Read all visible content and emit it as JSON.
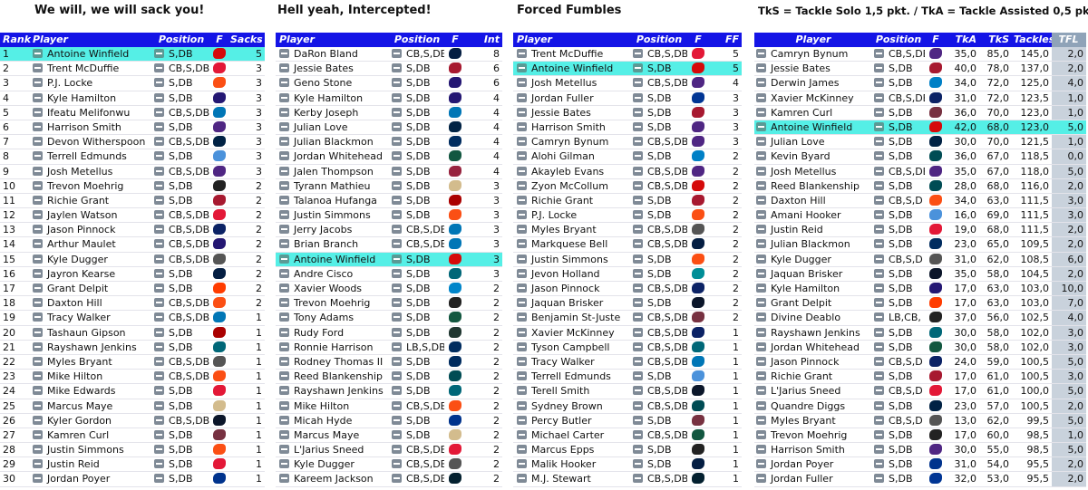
{
  "titles": {
    "sacks": "We will, we will sack you!",
    "ints": "Hell yeah, Intercepted!",
    "ff": "Forced Fumbles",
    "tackles": "TkS = Tackle Solo 1,5 pkt. / TkA = Tackle Assisted 0,5 pkt."
  },
  "team_colors": {
    "TB": "#d50a0a",
    "CIN": "#fb4f14",
    "DEN": "#fb4f14",
    "BAL": "#241773",
    "DET": "#0076b6",
    "MIN": "#4f2683",
    "TEN": "#4b92db",
    "LV": "#222222",
    "KC": "#e31837",
    "JAX": "#006778",
    "NYG": "#0b2265",
    "DAL": "#041e42",
    "CLE": "#ff3c00",
    "BUF": "#00338d",
    "CHI": "#0b162a",
    "WAS": "#773141",
    "HOU": "#03202f",
    "LAR": "#003594",
    "DAL2": "#041e42",
    "SF": "#aa0000",
    "IND": "#002c5f",
    "NYJ": "#125740",
    "ARI": "#97233f",
    "NO": "#d3bc8d",
    "CAR": "#0085ca",
    "GB": "#203731",
    "PHI": "#004c54",
    "ATL": "#a71930",
    "LAC": "#0080c6",
    "MIA": "#008e97",
    "SEA": "#002244",
    "PIT": "#ffb612"
  },
  "sacks_table": {
    "headers": [
      "Rank",
      "Player",
      "Position",
      "F",
      "Sacks"
    ],
    "rows": [
      {
        "rank": "1",
        "player": "Antoine Winfield",
        "pos": "S,DB",
        "team": "TB",
        "val": "5",
        "hl": true
      },
      {
        "rank": "2",
        "player": "Trent McDuffie",
        "pos": "CB,S,DB",
        "team": "KC",
        "val": "3"
      },
      {
        "rank": "3",
        "player": "P.J. Locke",
        "pos": "S,DB",
        "team": "DEN",
        "val": "3"
      },
      {
        "rank": "4",
        "player": "Kyle Hamilton",
        "pos": "S,DB",
        "team": "BAL",
        "val": "3"
      },
      {
        "rank": "5",
        "player": "Ifeatu Melifonwu",
        "pos": "CB,S,DB",
        "team": "DET",
        "val": "3"
      },
      {
        "rank": "6",
        "player": "Harrison Smith",
        "pos": "S,DB",
        "team": "MIN",
        "val": "3"
      },
      {
        "rank": "7",
        "player": "Devon Witherspoon",
        "pos": "CB,S,DB",
        "team": "SEA",
        "val": "3"
      },
      {
        "rank": "8",
        "player": "Terrell Edmunds",
        "pos": "S,DB",
        "team": "TEN",
        "val": "3"
      },
      {
        "rank": "9",
        "player": "Josh Metellus",
        "pos": "CB,S,DB",
        "team": "MIN",
        "val": "3"
      },
      {
        "rank": "10",
        "player": "Trevon Moehrig",
        "pos": "S,DB",
        "team": "LV",
        "val": "2"
      },
      {
        "rank": "11",
        "player": "Richie Grant",
        "pos": "S,DB",
        "team": "ATL",
        "val": "2"
      },
      {
        "rank": "12",
        "player": "Jaylen Watson",
        "pos": "CB,S,DB",
        "team": "KC",
        "val": "2"
      },
      {
        "rank": "13",
        "player": "Jason Pinnock",
        "pos": "CB,S,DB",
        "team": "NYG",
        "val": "2"
      },
      {
        "rank": "14",
        "player": "Arthur Maulet",
        "pos": "CB,S,DB",
        "team": "BAL",
        "val": "2"
      },
      {
        "rank": "15",
        "player": "Kyle Dugger",
        "pos": "CB,S,DB",
        "team": "NE",
        "val": "2"
      },
      {
        "rank": "16",
        "player": "Jayron Kearse",
        "pos": "S,DB",
        "team": "DAL",
        "val": "2"
      },
      {
        "rank": "17",
        "player": "Grant Delpit",
        "pos": "S,DB",
        "team": "CLE",
        "val": "2"
      },
      {
        "rank": "18",
        "player": "Daxton Hill",
        "pos": "CB,S,DB",
        "team": "CIN",
        "val": "2"
      },
      {
        "rank": "19",
        "player": "Tracy Walker",
        "pos": "CB,S,DB",
        "team": "DET",
        "val": "1"
      },
      {
        "rank": "20",
        "player": "Tashaun Gipson",
        "pos": "S,DB",
        "team": "SF",
        "val": "1"
      },
      {
        "rank": "21",
        "player": "Rayshawn Jenkins",
        "pos": "S,DB",
        "team": "JAX",
        "val": "1"
      },
      {
        "rank": "22",
        "player": "Myles Bryant",
        "pos": "CB,S,DB",
        "team": "NE",
        "val": "1"
      },
      {
        "rank": "23",
        "player": "Mike Hilton",
        "pos": "CB,S,DB",
        "team": "CIN",
        "val": "1"
      },
      {
        "rank": "24",
        "player": "Mike Edwards",
        "pos": "S,DB",
        "team": "KC",
        "val": "1"
      },
      {
        "rank": "25",
        "player": "Marcus Maye",
        "pos": "S,DB",
        "team": "NO",
        "val": "1"
      },
      {
        "rank": "26",
        "player": "Kyler Gordon",
        "pos": "CB,S,DB",
        "team": "CHI",
        "val": "1"
      },
      {
        "rank": "27",
        "player": "Kamren Curl",
        "pos": "S,DB",
        "team": "WAS",
        "val": "1"
      },
      {
        "rank": "28",
        "player": "Justin Simmons",
        "pos": "S,DB",
        "team": "DEN",
        "val": "1"
      },
      {
        "rank": "29",
        "player": "Justin Reid",
        "pos": "S,DB",
        "team": "KC",
        "val": "1"
      },
      {
        "rank": "30",
        "player": "Jordan Poyer",
        "pos": "S,DB",
        "team": "BUF",
        "val": "1"
      }
    ]
  },
  "ints_table": {
    "headers": [
      "Player",
      "Position",
      "F",
      "Int"
    ],
    "rows": [
      {
        "player": "DaRon Bland",
        "pos": "CB,S,DB",
        "team": "DAL",
        "val": "8"
      },
      {
        "player": "Jessie Bates",
        "pos": "S,DB",
        "team": "ATL",
        "val": "6"
      },
      {
        "player": "Geno Stone",
        "pos": "S,DB",
        "team": "BAL",
        "val": "6"
      },
      {
        "player": "Kyle Hamilton",
        "pos": "S,DB",
        "team": "BAL",
        "val": "4"
      },
      {
        "player": "Kerby Joseph",
        "pos": "S,DB",
        "team": "DET",
        "val": "4"
      },
      {
        "player": "Julian Love",
        "pos": "S,DB",
        "team": "SEA",
        "val": "4"
      },
      {
        "player": "Julian Blackmon",
        "pos": "S,DB",
        "team": "IND",
        "val": "4"
      },
      {
        "player": "Jordan Whitehead",
        "pos": "S,DB",
        "team": "NYJ",
        "val": "4"
      },
      {
        "player": "Jalen Thompson",
        "pos": "S,DB",
        "team": "ARI",
        "val": "4"
      },
      {
        "player": "Tyrann Mathieu",
        "pos": "S,DB",
        "team": "NO",
        "val": "3"
      },
      {
        "player": "Talanoa Hufanga",
        "pos": "S,DB",
        "team": "SF",
        "val": "3"
      },
      {
        "player": "Justin Simmons",
        "pos": "S,DB",
        "team": "DEN",
        "val": "3"
      },
      {
        "player": "Jerry Jacobs",
        "pos": "CB,S,DB",
        "team": "DET",
        "val": "3"
      },
      {
        "player": "Brian Branch",
        "pos": "CB,S,DB",
        "team": "DET",
        "val": "3"
      },
      {
        "player": "Antoine Winfield",
        "pos": "S,DB",
        "team": "TB",
        "val": "3",
        "hl": true
      },
      {
        "player": "Andre Cisco",
        "pos": "S,DB",
        "team": "JAX",
        "val": "3"
      },
      {
        "player": "Xavier Woods",
        "pos": "S,DB",
        "team": "CAR",
        "val": "2"
      },
      {
        "player": "Trevon Moehrig",
        "pos": "S,DB",
        "team": "LV",
        "val": "2"
      },
      {
        "player": "Tony Adams",
        "pos": "S,DB",
        "team": "NYJ",
        "val": "2"
      },
      {
        "player": "Rudy Ford",
        "pos": "S,DB",
        "team": "GB",
        "val": "2"
      },
      {
        "player": "Ronnie Harrison",
        "pos": "LB,S,DB",
        "team": "IND",
        "val": "2"
      },
      {
        "player": "Rodney Thomas II",
        "pos": "S,DB",
        "team": "IND",
        "val": "2"
      },
      {
        "player": "Reed Blankenship",
        "pos": "S,DB",
        "team": "PHI",
        "val": "2"
      },
      {
        "player": "Rayshawn Jenkins",
        "pos": "S,DB",
        "team": "JAX",
        "val": "2"
      },
      {
        "player": "Mike Hilton",
        "pos": "CB,S,DB",
        "team": "CIN",
        "val": "2"
      },
      {
        "player": "Micah Hyde",
        "pos": "S,DB",
        "team": "BUF",
        "val": "2"
      },
      {
        "player": "Marcus Maye",
        "pos": "S,DB",
        "team": "NO",
        "val": "2"
      },
      {
        "player": "L'Jarius Sneed",
        "pos": "CB,S,DB",
        "team": "KC",
        "val": "2"
      },
      {
        "player": "Kyle Dugger",
        "pos": "CB,S,DB",
        "team": "NE",
        "val": "2"
      },
      {
        "player": "Kareem Jackson",
        "pos": "CB,S,DB",
        "team": "HOU",
        "val": "2"
      }
    ]
  },
  "ff_table": {
    "headers": [
      "Player",
      "Position",
      "F",
      "FF"
    ],
    "rows": [
      {
        "player": "Trent McDuffie",
        "pos": "CB,S,DB",
        "team": "KC",
        "val": "5"
      },
      {
        "player": "Antoine Winfield",
        "pos": "S,DB",
        "team": "TB",
        "val": "5",
        "hl": true
      },
      {
        "player": "Josh Metellus",
        "pos": "CB,S,DB",
        "team": "MIN",
        "val": "4"
      },
      {
        "player": "Jordan Fuller",
        "pos": "S,DB",
        "team": "LAR",
        "val": "3"
      },
      {
        "player": "Jessie Bates",
        "pos": "S,DB",
        "team": "ATL",
        "val": "3"
      },
      {
        "player": "Harrison Smith",
        "pos": "S,DB",
        "team": "MIN",
        "val": "3"
      },
      {
        "player": "Camryn Bynum",
        "pos": "CB,S,DB",
        "team": "MIN",
        "val": "3"
      },
      {
        "player": "Alohi Gilman",
        "pos": "S,DB",
        "team": "LAC",
        "val": "2"
      },
      {
        "player": "Akayleb Evans",
        "pos": "CB,S,DB",
        "team": "MIN",
        "val": "2"
      },
      {
        "player": "Zyon McCollum",
        "pos": "CB,S,DB",
        "team": "TB",
        "val": "2"
      },
      {
        "player": "Richie Grant",
        "pos": "S,DB",
        "team": "ATL",
        "val": "2"
      },
      {
        "player": "P.J. Locke",
        "pos": "S,DB",
        "team": "DEN",
        "val": "2"
      },
      {
        "player": "Myles Bryant",
        "pos": "CB,S,DB",
        "team": "NE",
        "val": "2"
      },
      {
        "player": "Markquese Bell",
        "pos": "CB,S,DB",
        "team": "DAL",
        "val": "2"
      },
      {
        "player": "Justin Simmons",
        "pos": "S,DB",
        "team": "DEN",
        "val": "2"
      },
      {
        "player": "Jevon Holland",
        "pos": "S,DB",
        "team": "MIA",
        "val": "2"
      },
      {
        "player": "Jason Pinnock",
        "pos": "CB,S,DB",
        "team": "NYG",
        "val": "2"
      },
      {
        "player": "Jaquan Brisker",
        "pos": "S,DB",
        "team": "CHI",
        "val": "2"
      },
      {
        "player": "Benjamin St-Juste",
        "pos": "CB,S,DB",
        "team": "WAS",
        "val": "2"
      },
      {
        "player": "Xavier McKinney",
        "pos": "CB,S,DB",
        "team": "NYG",
        "val": "1"
      },
      {
        "player": "Tyson Campbell",
        "pos": "CB,S,DB",
        "team": "JAX",
        "val": "1"
      },
      {
        "player": "Tracy Walker",
        "pos": "CB,S,DB",
        "team": "DET",
        "val": "1"
      },
      {
        "player": "Terrell Edmunds",
        "pos": "S,DB",
        "team": "TEN",
        "val": "1"
      },
      {
        "player": "Terell Smith",
        "pos": "CB,S,DB",
        "team": "CHI",
        "val": "1"
      },
      {
        "player": "Sydney Brown",
        "pos": "CB,S,DB",
        "team": "PHI",
        "val": "1"
      },
      {
        "player": "Percy Butler",
        "pos": "S,DB",
        "team": "WAS",
        "val": "1"
      },
      {
        "player": "Michael Carter",
        "pos": "CB,S,DB",
        "team": "NYJ",
        "val": "1"
      },
      {
        "player": "Marcus Epps",
        "pos": "S,DB",
        "team": "LV",
        "val": "1"
      },
      {
        "player": "Malik Hooker",
        "pos": "S,DB",
        "team": "DAL",
        "val": "1"
      },
      {
        "player": "M.J. Stewart",
        "pos": "CB,S,DB",
        "team": "HOU",
        "val": "1"
      }
    ]
  },
  "tackles_table": {
    "headers": [
      "Player",
      "Position",
      "F",
      "TkA",
      "TkS",
      "Tackles",
      "TFL"
    ],
    "rows": [
      {
        "player": "Camryn Bynum",
        "pos": "CB,S,DB",
        "team": "MIN",
        "tka": "35,0",
        "tks": "85,0",
        "tackles": "145,0",
        "tfl": "2,0"
      },
      {
        "player": "Jessie Bates",
        "pos": "S,DB",
        "team": "ATL",
        "tka": "40,0",
        "tks": "78,0",
        "tackles": "137,0",
        "tfl": "2,0"
      },
      {
        "player": "Derwin James",
        "pos": "S,DB",
        "team": "LAC",
        "tka": "34,0",
        "tks": "72,0",
        "tackles": "125,0",
        "tfl": "4,0"
      },
      {
        "player": "Xavier McKinney",
        "pos": "CB,S,DB",
        "team": "NYG",
        "tka": "31,0",
        "tks": "72,0",
        "tackles": "123,5",
        "tfl": "1,0"
      },
      {
        "player": "Kamren Curl",
        "pos": "S,DB",
        "team": "WAS",
        "tka": "36,0",
        "tks": "70,0",
        "tackles": "123,0",
        "tfl": "1,0"
      },
      {
        "player": "Antoine Winfield",
        "pos": "S,DB",
        "team": "TB",
        "tka": "42,0",
        "tks": "68,0",
        "tackles": "123,0",
        "tfl": "5,0",
        "hl": true
      },
      {
        "player": "Julian Love",
        "pos": "S,DB",
        "team": "SEA",
        "tka": "30,0",
        "tks": "70,0",
        "tackles": "121,5",
        "tfl": "1,0"
      },
      {
        "player": "Kevin Byard",
        "pos": "S,DB",
        "team": "PHI",
        "tka": "36,0",
        "tks": "67,0",
        "tackles": "118,5",
        "tfl": "0,0"
      },
      {
        "player": "Josh Metellus",
        "pos": "CB,S,DB",
        "team": "MIN",
        "tka": "35,0",
        "tks": "67,0",
        "tackles": "118,0",
        "tfl": "5,0"
      },
      {
        "player": "Reed Blankenship",
        "pos": "S,DB",
        "team": "PHI",
        "tka": "28,0",
        "tks": "68,0",
        "tackles": "116,0",
        "tfl": "2,0"
      },
      {
        "player": "Daxton Hill",
        "pos": "CB,S,D",
        "team": "CIN",
        "tka": "34,0",
        "tks": "63,0",
        "tackles": "111,5",
        "tfl": "3,0"
      },
      {
        "player": "Amani Hooker",
        "pos": "S,DB",
        "team": "TEN",
        "tka": "16,0",
        "tks": "69,0",
        "tackles": "111,5",
        "tfl": "3,0"
      },
      {
        "player": "Justin Reid",
        "pos": "S,DB",
        "team": "KC",
        "tka": "19,0",
        "tks": "68,0",
        "tackles": "111,5",
        "tfl": "2,0"
      },
      {
        "player": "Julian Blackmon",
        "pos": "S,DB",
        "team": "IND",
        "tka": "23,0",
        "tks": "65,0",
        "tackles": "109,5",
        "tfl": "2,0"
      },
      {
        "player": "Kyle Dugger",
        "pos": "CB,S,D",
        "team": "NE",
        "tka": "31,0",
        "tks": "62,0",
        "tackles": "108,5",
        "tfl": "6,0"
      },
      {
        "player": "Jaquan Brisker",
        "pos": "S,DB",
        "team": "CHI",
        "tka": "35,0",
        "tks": "58,0",
        "tackles": "104,5",
        "tfl": "2,0"
      },
      {
        "player": "Kyle Hamilton",
        "pos": "S,DB",
        "team": "BAL",
        "tka": "17,0",
        "tks": "63,0",
        "tackles": "103,0",
        "tfl": "10,0"
      },
      {
        "player": "Grant Delpit",
        "pos": "S,DB",
        "team": "CLE",
        "tka": "17,0",
        "tks": "63,0",
        "tackles": "103,0",
        "tfl": "7,0"
      },
      {
        "player": "Divine Deablo",
        "pos": "LB,CB,",
        "team": "LV",
        "tka": "37,0",
        "tks": "56,0",
        "tackles": "102,5",
        "tfl": "4,0"
      },
      {
        "player": "Rayshawn Jenkins",
        "pos": "S,DB",
        "team": "JAX",
        "tka": "30,0",
        "tks": "58,0",
        "tackles": "102,0",
        "tfl": "3,0"
      },
      {
        "player": "Jordan Whitehead",
        "pos": "S,DB",
        "team": "NYJ",
        "tka": "30,0",
        "tks": "58,0",
        "tackles": "102,0",
        "tfl": "3,0"
      },
      {
        "player": "Jason Pinnock",
        "pos": "CB,S,D",
        "team": "NYG",
        "tka": "24,0",
        "tks": "59,0",
        "tackles": "100,5",
        "tfl": "5,0"
      },
      {
        "player": "Richie Grant",
        "pos": "S,DB",
        "team": "ATL",
        "tka": "17,0",
        "tks": "61,0",
        "tackles": "100,5",
        "tfl": "3,0"
      },
      {
        "player": "L'Jarius Sneed",
        "pos": "CB,S,D",
        "team": "KC",
        "tka": "17,0",
        "tks": "61,0",
        "tackles": "100,0",
        "tfl": "5,0"
      },
      {
        "player": "Quandre Diggs",
        "pos": "S,DB",
        "team": "SEA",
        "tka": "23,0",
        "tks": "57,0",
        "tackles": "100,5",
        "tfl": "2,0"
      },
      {
        "player": "Myles Bryant",
        "pos": "CB,S,D",
        "team": "NE",
        "tka": "13,0",
        "tks": "62,0",
        "tackles": "99,5",
        "tfl": "5,0"
      },
      {
        "player": "Trevon Moehrig",
        "pos": "S,DB",
        "team": "LV",
        "tka": "17,0",
        "tks": "60,0",
        "tackles": "98,5",
        "tfl": "1,0"
      },
      {
        "player": "Harrison Smith",
        "pos": "S,DB",
        "team": "MIN",
        "tka": "30,0",
        "tks": "55,0",
        "tackles": "98,5",
        "tfl": "5,0"
      },
      {
        "player": "Jordan Poyer",
        "pos": "S,DB",
        "team": "BUF",
        "tka": "31,0",
        "tks": "54,0",
        "tackles": "95,5",
        "tfl": "2,0"
      },
      {
        "player": "Jordan Fuller",
        "pos": "S,DB",
        "team": "LAR",
        "tka": "32,0",
        "tks": "53,0",
        "tackles": "95,5",
        "tfl": "2,0"
      }
    ]
  }
}
